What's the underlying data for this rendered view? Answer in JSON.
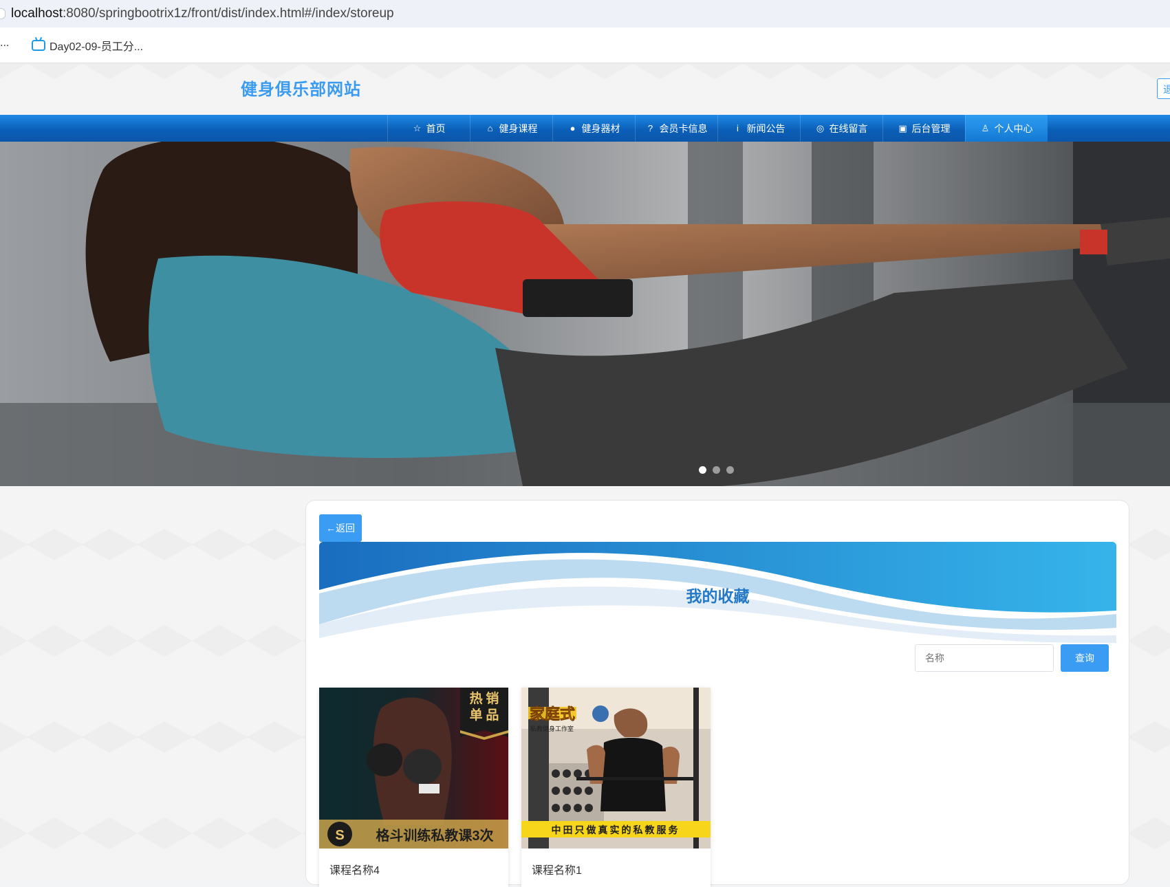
{
  "browser": {
    "url_host": "localhost",
    "url_rest": ":8080/springbootrix1z/front/dist/index.html#/index/storeup",
    "bookmark_more": "...",
    "bookmark_label": "Day02-09-员工分..."
  },
  "site": {
    "title": "健身俱乐部网站",
    "header_right_label": "退"
  },
  "nav": {
    "items": [
      {
        "label": "首页",
        "icon": "☆"
      },
      {
        "label": "健身课程",
        "icon": "⌂"
      },
      {
        "label": "健身器材",
        "icon": "●"
      },
      {
        "label": "会员卡信息",
        "icon": "?"
      },
      {
        "label": "新闻公告",
        "icon": "i"
      },
      {
        "label": "在线留言",
        "icon": "◎"
      },
      {
        "label": "后台管理",
        "icon": "▣"
      },
      {
        "label": "个人中心",
        "icon": "♙"
      }
    ],
    "active_index": 7
  },
  "carousel": {
    "slides": 3,
    "active": 0
  },
  "storeup": {
    "back_label": "←返回",
    "title": "我的收藏",
    "search_placeholder": "名称",
    "search_button": "查询",
    "cards": [
      {
        "name": "课程名称4",
        "badge_top": "热 销",
        "badge_bottom": "单 品",
        "caption": "格斗训练私教课3次"
      },
      {
        "name": "课程名称1",
        "tag_title": "家庭式",
        "tag_sub": "私教健身工作室",
        "caption": "中田只做真实的私教服务"
      }
    ]
  },
  "colors": {
    "accent": "#3a9cf3",
    "nav": "#0b5fb8",
    "title_blue": "#2379c7"
  }
}
